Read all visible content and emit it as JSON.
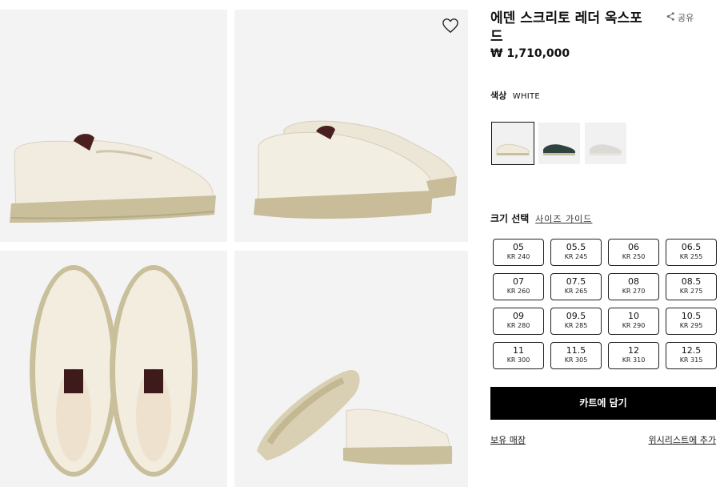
{
  "product": {
    "title": "에덴 스크리토 레더 옥스포드",
    "price": "₩ 1,710,000",
    "share_label": "공유"
  },
  "color": {
    "label": "색상",
    "selected": "WHITE",
    "swatches": [
      {
        "name": "white",
        "hex": "#efeadc"
      },
      {
        "name": "dark-green",
        "hex": "#2f4240"
      },
      {
        "name": "light-grey",
        "hex": "#dcdad6"
      }
    ]
  },
  "size": {
    "label": "크기 선택",
    "guide_label": "사이즈 가이드",
    "options": [
      {
        "eu": "05",
        "kr": "KR 240"
      },
      {
        "eu": "05.5",
        "kr": "KR 245"
      },
      {
        "eu": "06",
        "kr": "KR 250"
      },
      {
        "eu": "06.5",
        "kr": "KR 255"
      },
      {
        "eu": "07",
        "kr": "KR 260"
      },
      {
        "eu": "07.5",
        "kr": "KR 265"
      },
      {
        "eu": "08",
        "kr": "KR 270"
      },
      {
        "eu": "08.5",
        "kr": "KR 275"
      },
      {
        "eu": "09",
        "kr": "KR 280"
      },
      {
        "eu": "09.5",
        "kr": "KR 285"
      },
      {
        "eu": "10",
        "kr": "KR 290"
      },
      {
        "eu": "10.5",
        "kr": "KR 295"
      },
      {
        "eu": "11",
        "kr": "KR 300"
      },
      {
        "eu": "11.5",
        "kr": "KR 305"
      },
      {
        "eu": "12",
        "kr": "KR 310"
      },
      {
        "eu": "12.5",
        "kr": "KR 315"
      }
    ]
  },
  "actions": {
    "cart_label": "카트에 담기",
    "stores_label": "보유 매장",
    "wishlist_label": "위시리스트에 추가"
  },
  "icons": {
    "heart": "heart-icon",
    "share": "share-icon"
  }
}
